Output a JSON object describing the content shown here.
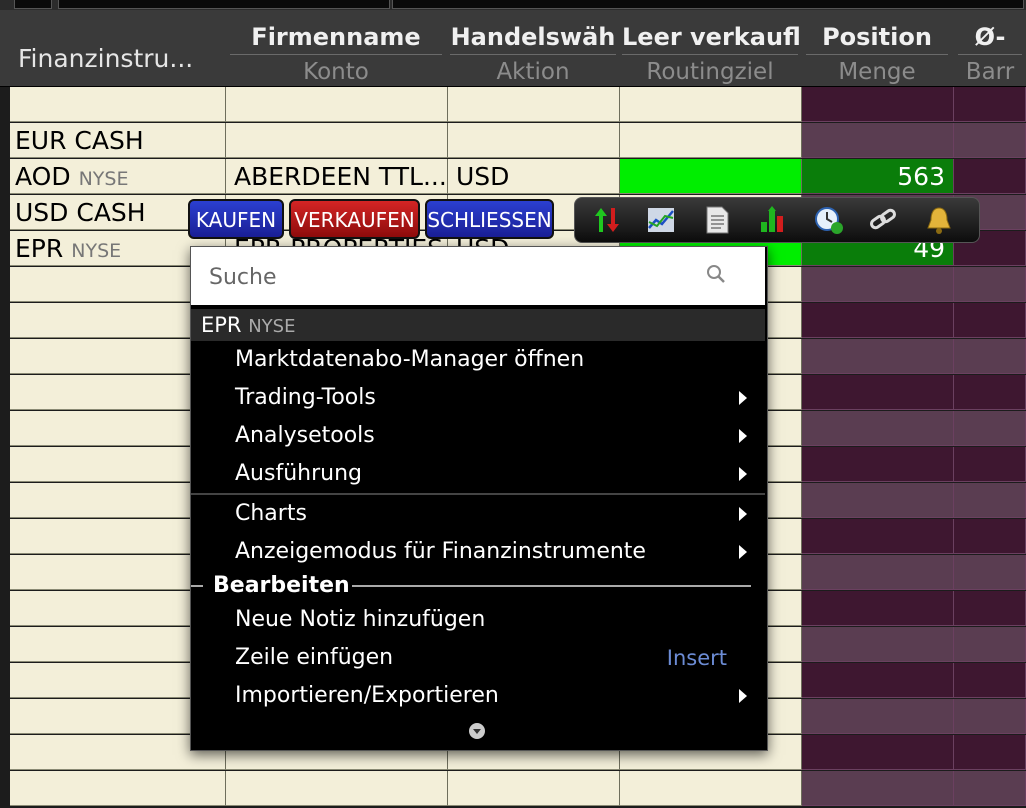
{
  "header": {
    "first_col": "Finanzinstru...",
    "columns": [
      {
        "title": "Firmenname",
        "sub": "Konto"
      },
      {
        "title": "Handelswäh",
        "sub": "Aktion"
      },
      {
        "title": "Leer verkaufl",
        "sub": "Routingziel"
      },
      {
        "title": "Position",
        "sub": "Menge"
      },
      {
        "title": "Ø-",
        "sub": "Barr"
      }
    ]
  },
  "rows": [
    {
      "symbol": "",
      "exchange": "",
      "company": "",
      "currency": "",
      "position": ""
    },
    {
      "symbol": "EUR CASH",
      "exchange": "",
      "company": "",
      "currency": "",
      "position": ""
    },
    {
      "symbol": "AOD",
      "exchange": "NYSE",
      "company": "ABERDEEN TTL...",
      "currency": "USD",
      "position": "563"
    },
    {
      "symbol": "USD CASH",
      "exchange": "",
      "company": "",
      "currency": "",
      "position": ""
    },
    {
      "symbol": "EPR",
      "exchange": "NYSE",
      "company": "EPR PROPERTIES",
      "currency": "USD",
      "position": "49"
    }
  ],
  "order_buttons": {
    "buy": "KAUFEN",
    "sell": "VERKAUFEN",
    "close": "SCHLIESSEN"
  },
  "toolbar_icons": [
    "trade-arrows-icon",
    "chart-icon",
    "document-icon",
    "bar-chart-icon",
    "clock-icon",
    "link-icon",
    "bell-icon"
  ],
  "menu": {
    "search_placeholder": "Suche",
    "header_symbol": "EPR",
    "header_exchange": "NYSE",
    "items": [
      {
        "label": "Marktdatenabo-Manager öffnen"
      },
      {
        "label": "Trading-Tools"
      },
      {
        "label": "Analysetools"
      },
      {
        "label": "Ausführung"
      },
      {
        "label": "Charts"
      },
      {
        "label": "Anzeigemodus für Finanzinstrumente"
      }
    ],
    "section": "Bearbeiten",
    "edit_items": [
      {
        "label": "Neue Notiz hinzufügen"
      },
      {
        "label": "Zeile einfügen",
        "shortcut": "Insert"
      },
      {
        "label": "Importieren/Exportieren"
      }
    ]
  },
  "colors": {
    "green": "#00ee00",
    "dark_green": "#0a7d0a",
    "cream": "#f3efd9",
    "plum": "#3e1730"
  }
}
